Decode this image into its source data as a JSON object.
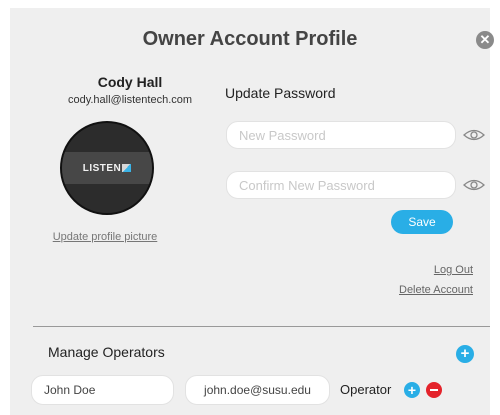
{
  "dialog": {
    "title": "Owner Account Profile",
    "close_icon": "close-circle-icon"
  },
  "profile": {
    "name": "Cody Hall",
    "email": "cody.hall@listentech.com",
    "avatar_logo_text": "LISTEN",
    "update_picture_label": "Update profile picture"
  },
  "password": {
    "heading": "Update Password",
    "new_placeholder": "New Password",
    "confirm_placeholder": "Confirm New Password",
    "eye_icon": "eye-icon",
    "save_label": "Save"
  },
  "account_links": {
    "logout": "Log Out",
    "delete": "Delete Account"
  },
  "operators": {
    "heading": "Manage Operators",
    "add_icon": "plus-circle-icon",
    "rows": [
      {
        "name": "John Doe",
        "email": "john.doe@susu.edu",
        "role": "Operator"
      }
    ]
  },
  "colors": {
    "accent_blue": "#29aee6",
    "remove_red": "#e4232b",
    "panel_bg": "#efefef"
  }
}
